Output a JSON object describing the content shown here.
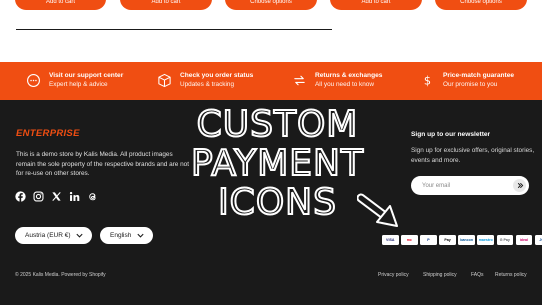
{
  "products": {
    "buttons": [
      "Add to cart",
      "Add to cart",
      "Choose options",
      "Add to cart",
      "Choose options"
    ]
  },
  "features": [
    {
      "title": "Visit our support center",
      "subtitle": "Expert help & advice",
      "icon": "chat-icon"
    },
    {
      "title": "Check you order status",
      "subtitle": "Updates & tracking",
      "icon": "box-icon"
    },
    {
      "title": "Returns & exchanges",
      "subtitle": "All you need to know",
      "icon": "returns-icon"
    },
    {
      "title": "Price-match guarantee",
      "subtitle": "Our promise to you",
      "icon": "dollar-icon"
    }
  ],
  "footer": {
    "brand": "ENTERPRISE",
    "about": "This is a demo store by Kalis Media. All product images remain the sole property of the respective brands and are not for re-use on other stores.",
    "socials": [
      "facebook-icon",
      "instagram-icon",
      "x-icon",
      "linkedin-icon",
      "threads-icon"
    ],
    "country_select": "Austria (EUR €)",
    "language_select": "English",
    "newsletter": {
      "title": "Sign up to our newsletter",
      "text": "Sign up for exclusive offers, original stories, events and more.",
      "placeholder": "Your email"
    },
    "overlay_text": [
      "CUSTOM",
      "PAYMENT",
      "ICONS"
    ],
    "payment_icons": [
      {
        "label": "VISA",
        "color": "#1a1f71"
      },
      {
        "label": "mc",
        "color": "#eb001b"
      },
      {
        "label": "P",
        "color": "#003087"
      },
      {
        "label": "Pay",
        "color": "#000000"
      },
      {
        "label": "bancon",
        "color": "#005498"
      },
      {
        "label": "maestro",
        "color": "#0099df"
      },
      {
        "label": "G Pay",
        "color": "#5f6368"
      },
      {
        "label": "ideal",
        "color": "#cc0066"
      },
      {
        "label": "JCB",
        "color": "#0e4c96"
      }
    ],
    "copyright": "© 2025 Kalis Media. Powered by Shopify",
    "links": [
      "Privacy policy",
      "Shipping policy",
      "FAQs",
      "Returns policy"
    ]
  },
  "colors": {
    "accent": "#f04e12",
    "dark": "#1a1a1a"
  }
}
